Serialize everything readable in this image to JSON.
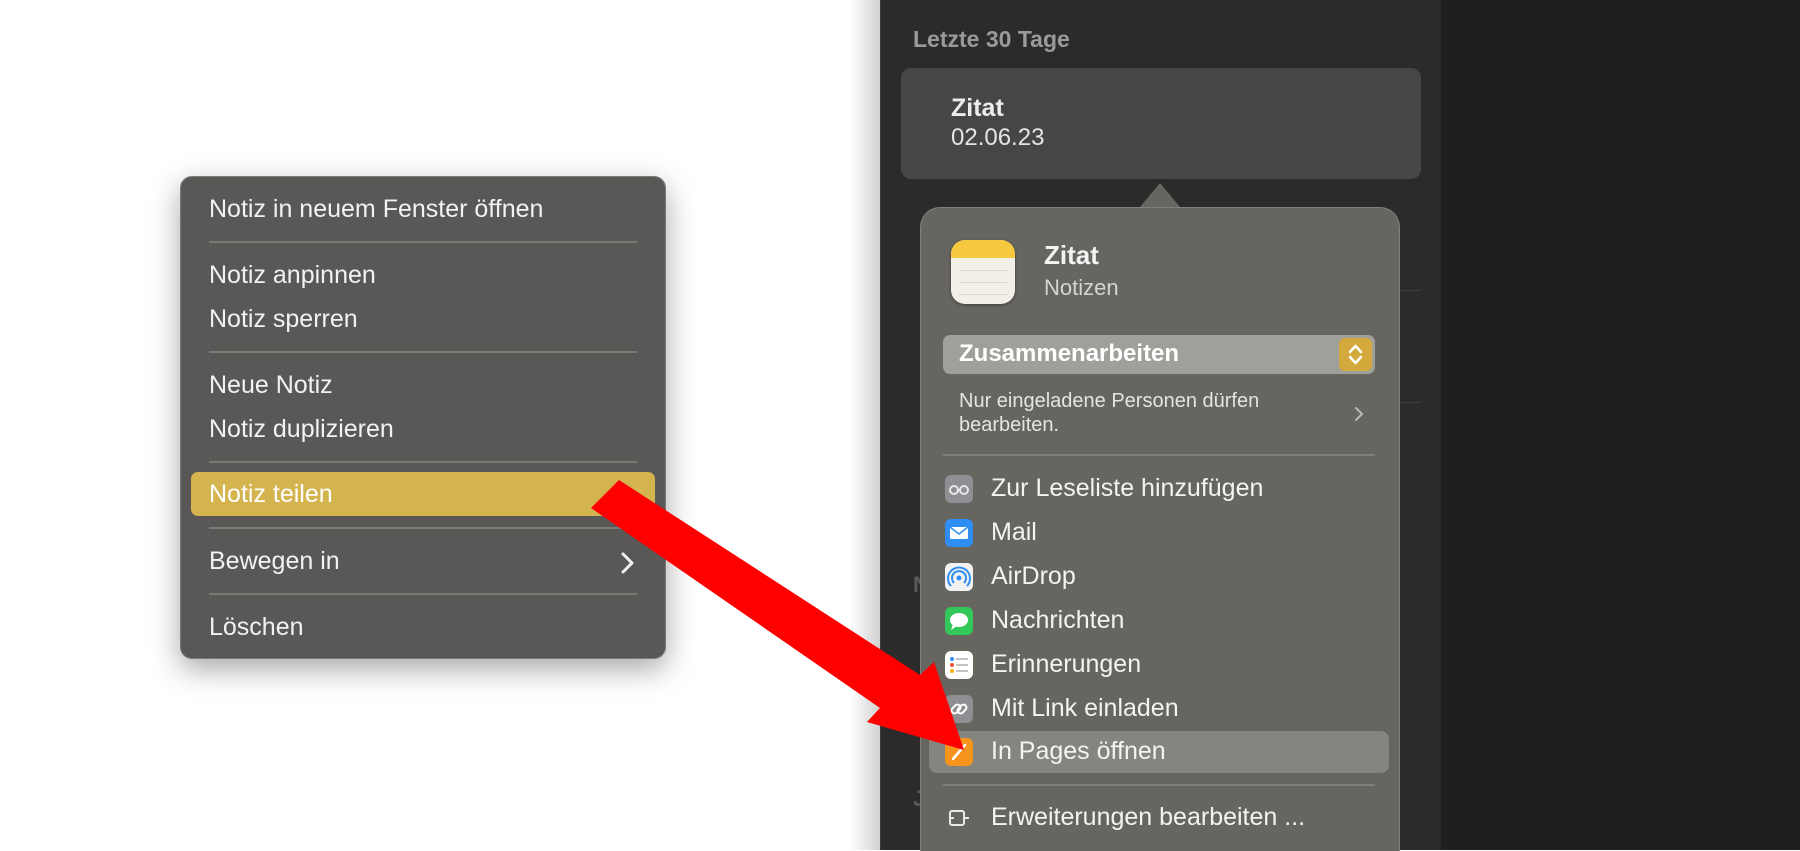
{
  "note_list": {
    "section_header": "Letzte 30 Tage",
    "selected_note": {
      "title": "Zitat",
      "date": "02.06.23"
    }
  },
  "context_menu": {
    "items": [
      {
        "label": "Notiz in neuem Fenster öffnen"
      },
      {
        "label": "Notiz anpinnen"
      },
      {
        "label": "Notiz sperren"
      },
      {
        "label": "Neue Notiz"
      },
      {
        "label": "Notiz duplizieren"
      },
      {
        "label": "Notiz teilen",
        "highlighted": true
      },
      {
        "label": "Bewegen in",
        "submenu": true
      },
      {
        "label": "Löschen"
      }
    ]
  },
  "share_popover": {
    "app_title": "Zitat",
    "app_subtitle": "Notizen",
    "collaboration_select": "Zusammenarbeiten",
    "permission_text": "Nur eingeladene Personen dürfen bearbeiten.",
    "options": [
      {
        "label": "Zur Leseliste hinzufügen",
        "icon": "reading-list-icon",
        "color": "#8e8e93"
      },
      {
        "label": "Mail",
        "icon": "mail-icon",
        "color": "#2f8ef4"
      },
      {
        "label": "AirDrop",
        "icon": "airdrop-icon",
        "color": "#f2f2f2"
      },
      {
        "label": "Nachrichten",
        "icon": "messages-icon",
        "color": "#34c759"
      },
      {
        "label": "Erinnerungen",
        "icon": "reminders-icon",
        "color": "#ffffff"
      },
      {
        "label": "Mit Link einladen",
        "icon": "link-icon",
        "color": "#8e8e93"
      },
      {
        "label": "In Pages öffnen",
        "icon": "pages-icon",
        "color": "#f7941d",
        "highlighted": true
      }
    ],
    "edit_extensions": "Erweiterungen bearbeiten ..."
  },
  "colors": {
    "menu_highlight": "#d4b44f",
    "annotation_arrow": "#ff0000",
    "stepper": "#d4a93c"
  }
}
